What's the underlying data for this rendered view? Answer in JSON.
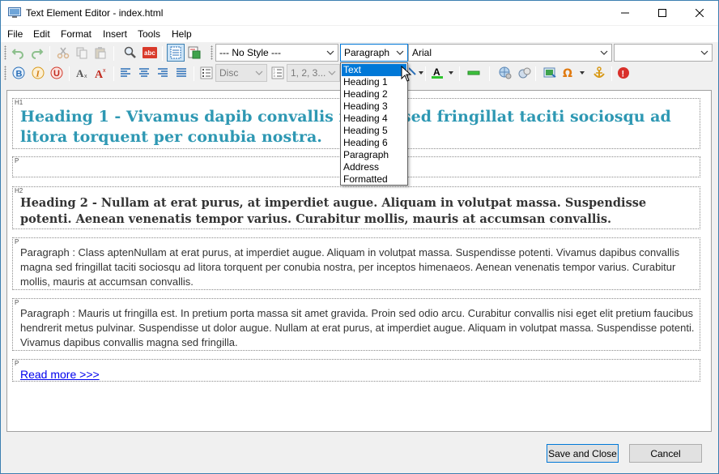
{
  "window": {
    "title": "Text Element Editor - index.html"
  },
  "menu": [
    "File",
    "Edit",
    "Format",
    "Insert",
    "Tools",
    "Help"
  ],
  "toolbar": {
    "style_combo": "--- No Style ---",
    "format_combo": "Paragraph",
    "font_combo": "Arial",
    "size_combo": "",
    "bullet_combo": "Disc",
    "numbering_combo": "1, 2, 3...",
    "colors": {
      "text_color": "#000000",
      "highlight_color": "#2ec42e"
    }
  },
  "format_dropdown": {
    "options": [
      "Text",
      "Heading 1",
      "Heading 2",
      "Heading 3",
      "Heading 4",
      "Heading 5",
      "Heading 6",
      "Paragraph",
      "Address",
      "Formatted"
    ],
    "selected": "Text"
  },
  "document": {
    "blocks": [
      {
        "tag": "H1",
        "text": "Heading 1 - Vivamus dapib convallis magna sed fringillat taciti sociosqu ad litora torquent per conubia nostra."
      },
      {
        "tag": "P",
        "text": ""
      },
      {
        "tag": "H2",
        "text": "Heading 2 - Nullam at erat purus, at imperdiet augue. Aliquam in volutpat massa. Suspendisse potenti. Aenean venenatis tempor varius. Curabitur mollis, mauris at accumsan convallis."
      },
      {
        "tag": "P",
        "text": "Paragraph : Class aptenNullam at erat purus, at imperdiet augue. Aliquam in volutpat massa. Suspendisse potenti. Vivamus dapibus convallis magna sed fringillat taciti sociosqu ad litora torquent per conubia nostra, per inceptos himenaeos. Aenean venenatis tempor varius. Curabitur mollis, mauris at accumsan convallis."
      },
      {
        "tag": "P",
        "text": "Paragraph : Mauris ut fringilla est. In pretium porta massa sit amet gravida. Proin sed odio arcu. Curabitur convallis nisi eget elit pretium faucibus hendrerit metus pulvinar. Suspendisse ut dolor augue. Nullam at erat purus, at imperdiet augue. Aliquam in volutpat massa. Suspendisse potenti. Vivamus dapibus convallis magna sed fringilla."
      },
      {
        "tag": "P",
        "text": "Read more >>>"
      }
    ]
  },
  "buttons": {
    "save_close": "Save and Close",
    "cancel": "Cancel"
  },
  "theme": {
    "heading1_color": "#2e98b3",
    "link_color": "#0000ee",
    "accent": "#0078d7"
  }
}
